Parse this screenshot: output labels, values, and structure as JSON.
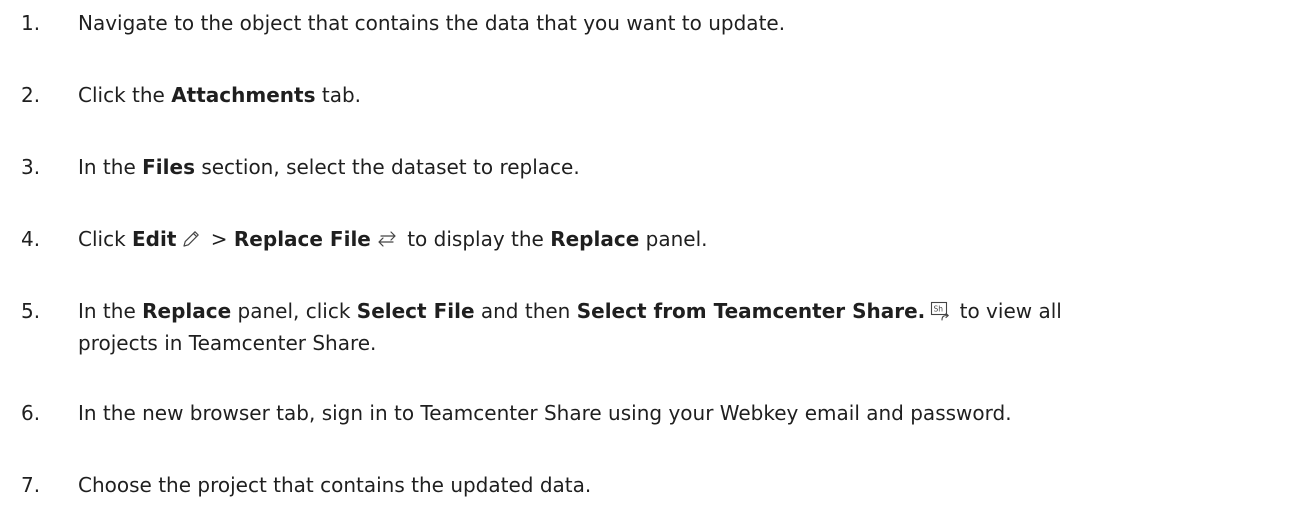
{
  "steps": [
    {
      "number": "1.",
      "text": "Navigate to the object that contains the data that you want to update."
    },
    {
      "number": "2.",
      "pre": "Click the ",
      "bold": "Attachments",
      "post": " tab."
    },
    {
      "number": "3.",
      "pre": "In the ",
      "bold": "Files",
      "post": " section, select the dataset to replace."
    },
    {
      "number": "4.",
      "pre": "Click ",
      "bold1": "Edit",
      "icon1": "pencil-edit-icon",
      "sep": " > ",
      "bold2": "Replace File",
      "icon2": "replace-arrows-icon",
      "mid": " to display the ",
      "bold3": "Replace",
      "post": " panel."
    },
    {
      "number": "5.",
      "pre": "In the ",
      "bold1": "Replace",
      "mid1": " panel, click ",
      "bold2": "Select File",
      "mid2": " and then ",
      "bold3": "Select from Teamcenter Share.",
      "icon": "teamcenter-share-icon",
      "icon_text": "Sh",
      "post_line1": " to view all",
      "post_line2": "projects in Teamcenter Share."
    },
    {
      "number": "6.",
      "text": "In the new browser tab, sign in to Teamcenter Share using your Webkey email and password."
    },
    {
      "number": "7.",
      "text": "Choose the project that contains the updated data."
    }
  ]
}
